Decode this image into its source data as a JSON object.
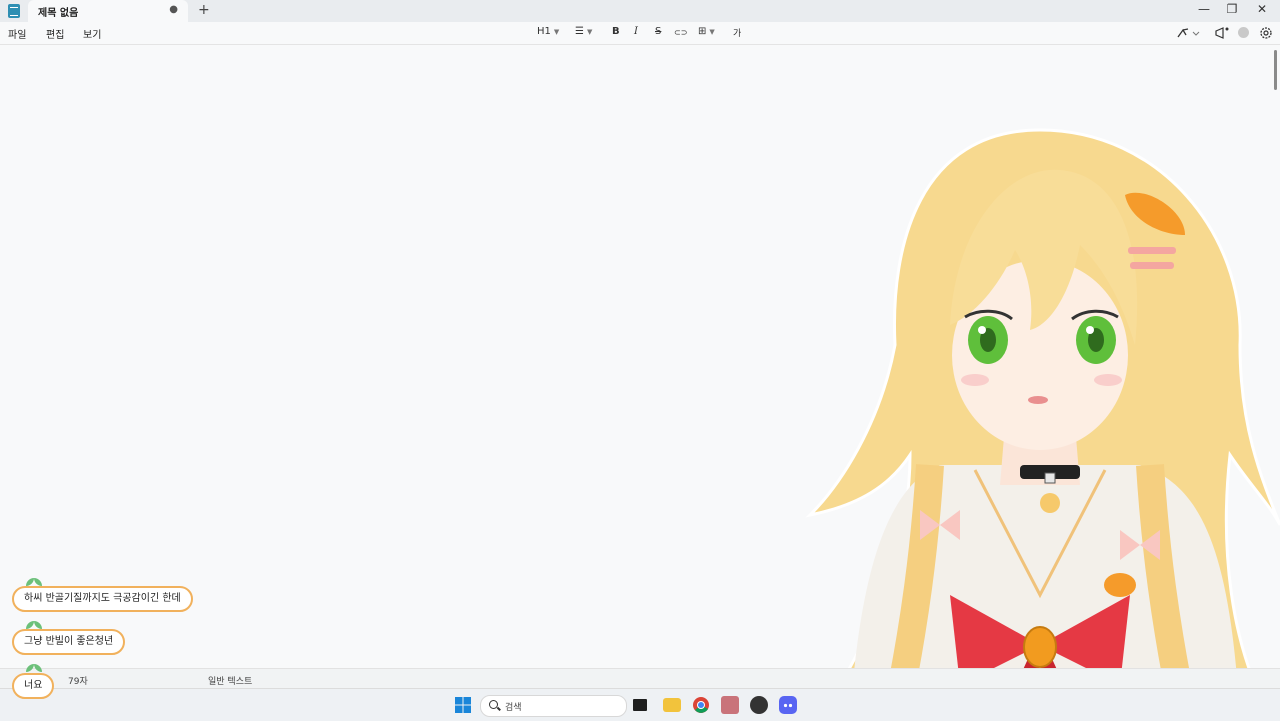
{
  "window": {
    "tab_title": "제목 없음",
    "tab_unsaved_marker": "●",
    "new_tab": "+",
    "minimize": "—",
    "maximize": "❐",
    "close": "✕"
  },
  "menu": {
    "file": "파일",
    "edit": "편집",
    "view": "보기"
  },
  "toolbar": {
    "heading": "H1",
    "list_glyph": "☰",
    "bold": "B",
    "italic": "I",
    "strikethrough": "S",
    "link_glyph": "⊂⊃",
    "table_glyph": "⊞",
    "spellcheck_glyph": "가"
  },
  "status": {
    "char_count": "79자",
    "format": "일반 텍스트"
  },
  "chat": {
    "messages": [
      "하씨 반골기질까지도 극공감이긴 한데",
      "그냥 반빌이 좋은청년",
      "너요"
    ]
  },
  "taskbar": {
    "search_placeholder": "검색"
  },
  "colors": {
    "chat_border": "#f1b15c",
    "leaf": "#6cc07a",
    "hair": "#f7d98f",
    "eyes": "#5fbf3b",
    "bow": "#e53944"
  }
}
